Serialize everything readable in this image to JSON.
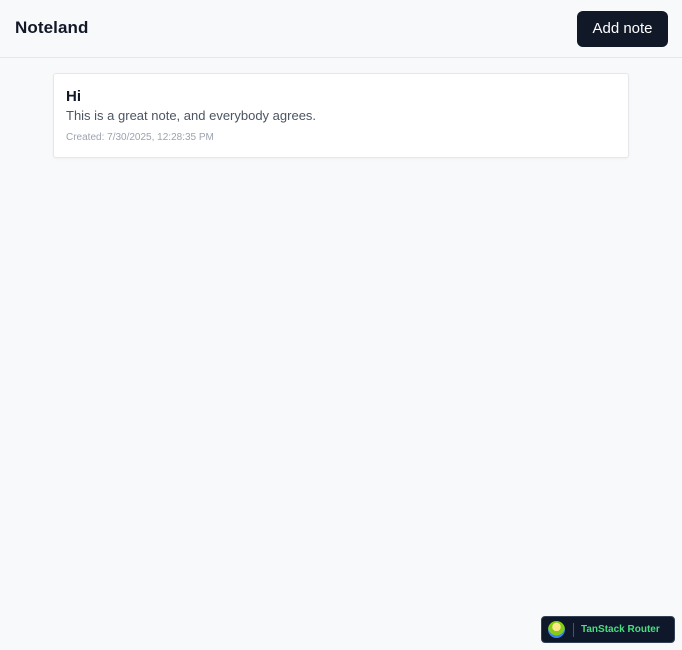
{
  "header": {
    "brand": "Noteland",
    "add_note_label": "Add note"
  },
  "notes": [
    {
      "title": "Hi",
      "body": "This is a great note, and everybody agrees.",
      "created": "Created: 7/30/2025, 12:28:35 PM"
    }
  ],
  "devtools": {
    "label": "TanStack Router",
    "icon": "tanstack-logo-icon"
  },
  "colors": {
    "background": "#f8f9fa",
    "button_bg": "#111827",
    "devtools_bg": "#0f172a",
    "devtools_text": "#4ade80"
  }
}
